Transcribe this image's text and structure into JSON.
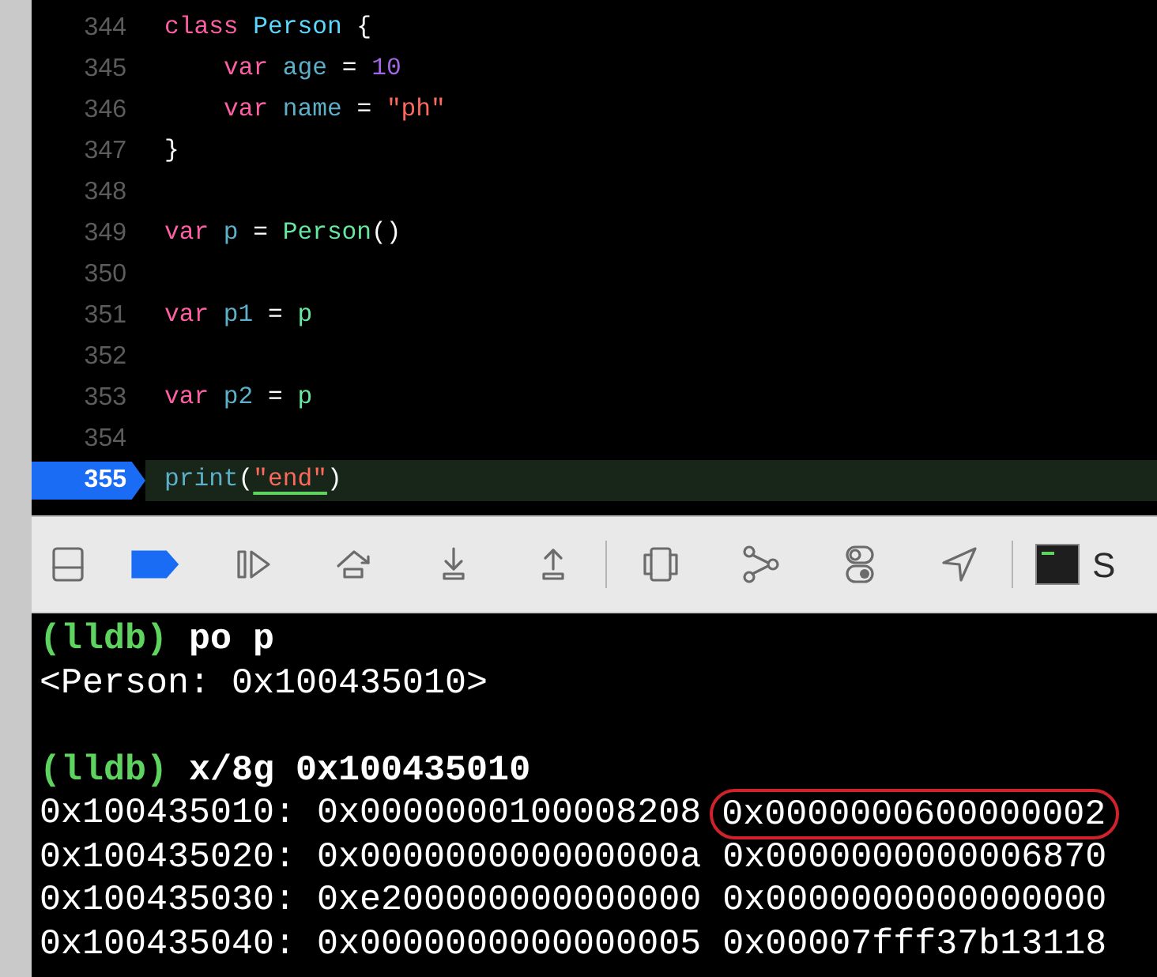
{
  "editor": {
    "lines": [
      {
        "number": "344",
        "current": false,
        "tokens": [
          {
            "text": "class",
            "kind": "keyword"
          },
          {
            "text": " Person",
            "kind": "type"
          },
          {
            "text": " {",
            "kind": "plain"
          }
        ],
        "children": [
          {
            "number": "345",
            "current": false,
            "tokens": [
              {
                "text": "var",
                "kind": "keyword"
              },
              {
                "text": " age",
                "kind": "ident"
              },
              {
                "text": " =",
                "kind": "plain"
              },
              {
                "text": " 10",
                "kind": "number"
              }
            ]
          },
          {
            "number": "346",
            "current": false,
            "tokens": [
              {
                "text": "var",
                "kind": "keyword"
              },
              {
                "text": " name",
                "kind": "ident"
              },
              {
                "text": " =",
                "kind": "plain"
              },
              {
                "text": " \"ph\"",
                "kind": "string"
              }
            ]
          }
        ]
      },
      {
        "number": "347",
        "current": false,
        "tokens": [
          {
            "text": "}",
            "kind": "plain"
          }
        ]
      },
      {
        "number": "348",
        "current": false
      },
      {
        "number": "349",
        "current": false,
        "tokens": [
          {
            "text": "var",
            "kind": "keyword"
          },
          {
            "text": " p",
            "kind": "ident"
          },
          {
            "text": " =",
            "kind": "plain"
          },
          {
            "text": " Person",
            "kind": "ref"
          },
          {
            "text": "()",
            "kind": "plain"
          }
        ]
      },
      {
        "number": "350",
        "current": false
      },
      {
        "number": "351",
        "current": false,
        "tokens": [
          {
            "text": "var",
            "kind": "keyword"
          },
          {
            "text": " p1",
            "kind": "ident"
          },
          {
            "text": " =",
            "kind": "plain"
          },
          {
            "text": " p",
            "kind": "ref"
          }
        ]
      },
      {
        "number": "352",
        "current": false
      },
      {
        "number": "353",
        "current": false,
        "tokens": [
          {
            "text": "var",
            "kind": "keyword"
          },
          {
            "text": " p2",
            "kind": "ident"
          },
          {
            "text": " =",
            "kind": "plain"
          },
          {
            "text": " p",
            "kind": "ref"
          }
        ]
      },
      {
        "number": "354",
        "current": false
      },
      {
        "number": "355",
        "current": true,
        "tokens": [
          {
            "text": "print",
            "kind": "ident"
          },
          {
            "text": "(",
            "kind": "plain"
          },
          {
            "text": "\"end\"",
            "kind": "marked-string"
          },
          {
            "text": ")",
            "kind": "plain"
          }
        ]
      }
    ]
  },
  "debug_bar": {
    "breakpoints_active": true,
    "target_label": "S"
  },
  "console": {
    "lines": [
      {
        "kind": "command",
        "prompt": "(lldb)",
        "text": "po p"
      },
      {
        "kind": "output",
        "text": "<Person: 0x100435010>"
      },
      {
        "kind": "blank"
      },
      {
        "kind": "command",
        "prompt": "(lldb)",
        "text": "x/8g 0x100435010"
      },
      {
        "kind": "memory",
        "address": "0x100435010:",
        "values": [
          {
            "text": "0x0000000100008208",
            "circled": false
          },
          {
            "text": "0x0000000600000002",
            "circled": true
          }
        ]
      },
      {
        "kind": "memory",
        "address": "0x100435020:",
        "values": [
          {
            "text": "0x000000000000000a",
            "circled": false
          },
          {
            "text": "0x0000000000006870",
            "circled": false
          }
        ]
      },
      {
        "kind": "memory",
        "address": "0x100435030:",
        "values": [
          {
            "text": "0xe200000000000000",
            "circled": false
          },
          {
            "text": "0x0000000000000000",
            "circled": false
          }
        ]
      },
      {
        "kind": "memory",
        "address": "0x100435040:",
        "values": [
          {
            "text": "0x0000000000000005",
            "circled": false
          },
          {
            "text": "0x00007fff37b13118",
            "circled": false
          }
        ]
      }
    ]
  }
}
